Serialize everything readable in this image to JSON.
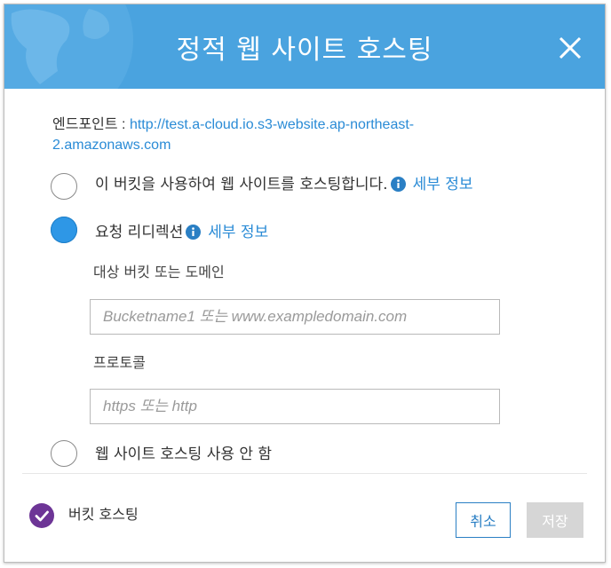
{
  "dialog": {
    "title": "정적 웹 사이트 호스팅",
    "close_icon": "close-icon"
  },
  "endpoint": {
    "label": "엔드포인트 :",
    "url": "http://test.a-cloud.io.s3-website.ap-northeast-2.amazonaws.com"
  },
  "options": {
    "host": {
      "label": "이 버킷을 사용하여 웹 사이트를 호스팅합니다.",
      "more": "세부 정보",
      "selected": false
    },
    "redirect": {
      "label": "요청 리디렉션",
      "more": "세부 정보",
      "selected": true
    },
    "disable": {
      "label": "웹 사이트 호스팅 사용 안 함",
      "selected": false
    }
  },
  "redirect_form": {
    "target_label": "대상 버킷 또는 도메인",
    "target_placeholder": "Bucketname1 또는 www.exampledomain.com",
    "protocol_label": "프로토콜",
    "protocol_placeholder": "https 또는 http"
  },
  "footer": {
    "status_label": "버킷 호스팅",
    "cancel_label": "취소",
    "save_label": "저장"
  },
  "colors": {
    "header": "#4aa3df",
    "accent": "#2e97e6",
    "link": "#2a8bd6",
    "check": "#6d3596"
  }
}
